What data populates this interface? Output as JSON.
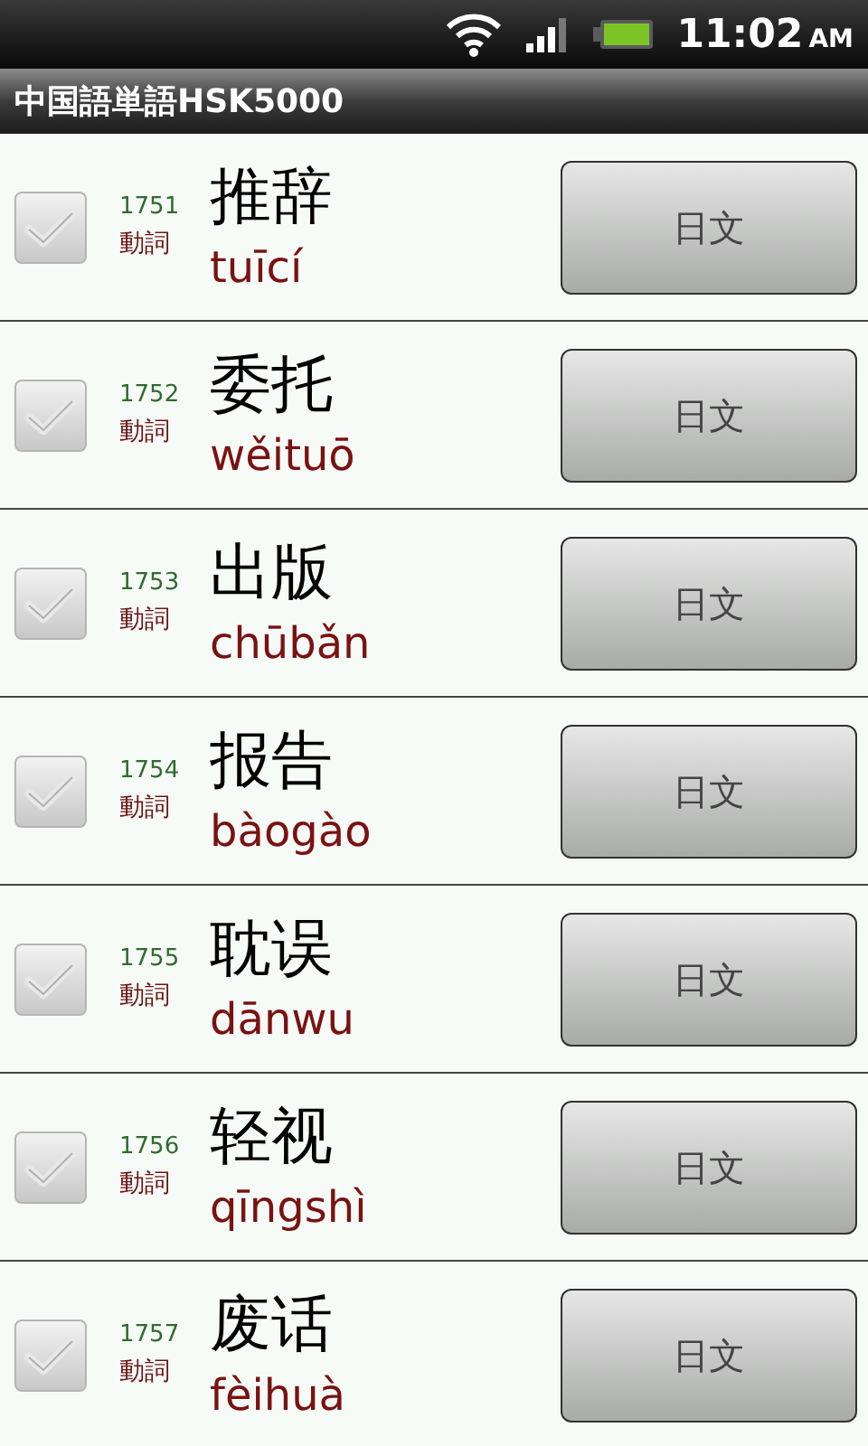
{
  "status_bar": {
    "time": "11:02",
    "ampm": "AM"
  },
  "title": "中国語単語HSK5000",
  "words": [
    {
      "number": "1751",
      "pos": "動詞",
      "hanzi": "推辞",
      "pinyin": "tuīcí",
      "checked": false,
      "button": "日文"
    },
    {
      "number": "1752",
      "pos": "動詞",
      "hanzi": "委托",
      "pinyin": "wěituō",
      "checked": false,
      "button": "日文"
    },
    {
      "number": "1753",
      "pos": "動詞",
      "hanzi": "出版",
      "pinyin": "chūbǎn",
      "checked": false,
      "button": "日文"
    },
    {
      "number": "1754",
      "pos": "動詞",
      "hanzi": "报告",
      "pinyin": "bàogào",
      "checked": false,
      "button": "日文"
    },
    {
      "number": "1755",
      "pos": "動詞",
      "hanzi": "耽误",
      "pinyin": "dānwu",
      "checked": false,
      "button": "日文"
    },
    {
      "number": "1756",
      "pos": "動詞",
      "hanzi": "轻视",
      "pinyin": "qīngshì",
      "checked": false,
      "button": "日文"
    },
    {
      "number": "1757",
      "pos": "動詞",
      "hanzi": "废话",
      "pinyin": "fèihuà",
      "checked": false,
      "button": "日文"
    }
  ]
}
